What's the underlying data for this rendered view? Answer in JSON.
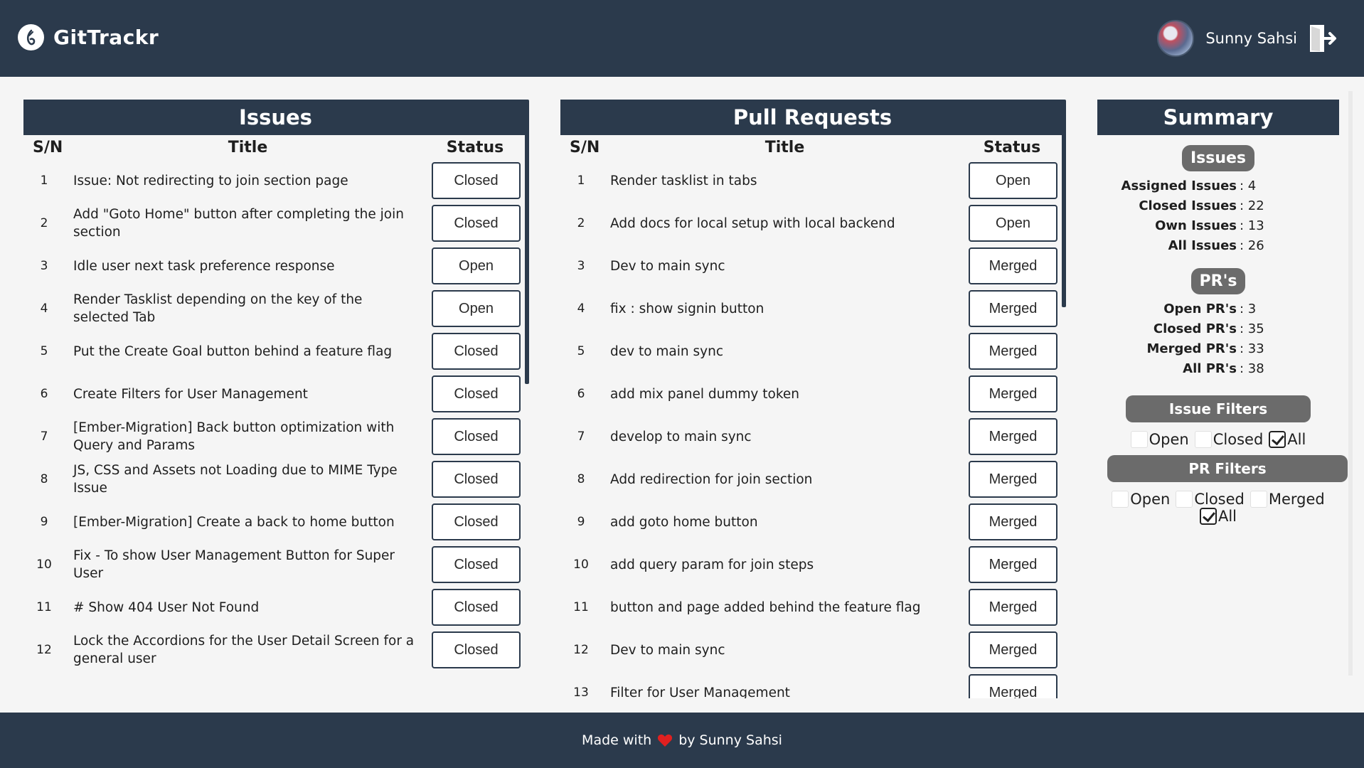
{
  "header": {
    "brand": "GitTrackr",
    "user_name": "Sunny Sahsi"
  },
  "issues": {
    "title": "Issues",
    "columns": [
      "S/N",
      "Title",
      "Status"
    ],
    "rows": [
      {
        "sn": "1",
        "title": "Issue: Not redirecting to join section page",
        "status": "Closed"
      },
      {
        "sn": "2",
        "title": "Add \"Goto Home\" button after completing the join section",
        "status": "Closed"
      },
      {
        "sn": "3",
        "title": "Idle user next task preference response",
        "status": "Open"
      },
      {
        "sn": "4",
        "title": "Render Tasklist depending on the key of the selected Tab",
        "status": "Open"
      },
      {
        "sn": "5",
        "title": "Put the Create Goal button behind a feature flag",
        "status": "Closed"
      },
      {
        "sn": "6",
        "title": "Create Filters for User Management",
        "status": "Closed"
      },
      {
        "sn": "7",
        "title": "[Ember-Migration] Back button optimization with Query and Params",
        "status": "Closed"
      },
      {
        "sn": "8",
        "title": "JS, CSS and Assets not Loading due to MIME Type Issue",
        "status": "Closed"
      },
      {
        "sn": "9",
        "title": "[Ember-Migration] Create a back to home button",
        "status": "Closed"
      },
      {
        "sn": "10",
        "title": "Fix - To show User Management Button for Super User",
        "status": "Closed"
      },
      {
        "sn": "11",
        "title": "# Show 404 User Not Found",
        "status": "Closed"
      },
      {
        "sn": "12",
        "title": "Lock the Accordions for the User Detail Screen for a general user",
        "status": "Closed"
      }
    ]
  },
  "pull_requests": {
    "title": "Pull Requests",
    "columns": [
      "S/N",
      "Title",
      "Status"
    ],
    "rows": [
      {
        "sn": "1",
        "title": "Render tasklist in tabs",
        "status": "Open"
      },
      {
        "sn": "2",
        "title": "Add docs for local setup with local backend",
        "status": "Open"
      },
      {
        "sn": "3",
        "title": "Dev to main sync",
        "status": "Merged"
      },
      {
        "sn": "4",
        "title": "fix : show signin button",
        "status": "Merged"
      },
      {
        "sn": "5",
        "title": "dev to main sync",
        "status": "Merged"
      },
      {
        "sn": "6",
        "title": "add mix panel dummy token",
        "status": "Merged"
      },
      {
        "sn": "7",
        "title": "develop to main sync",
        "status": "Merged"
      },
      {
        "sn": "8",
        "title": "Add redirection for join section",
        "status": "Merged"
      },
      {
        "sn": "9",
        "title": "add goto home button",
        "status": "Merged"
      },
      {
        "sn": "10",
        "title": "add query param for join steps",
        "status": "Merged"
      },
      {
        "sn": "11",
        "title": "button and page added behind the feature flag",
        "status": "Merged"
      },
      {
        "sn": "12",
        "title": "Dev to main sync",
        "status": "Merged"
      },
      {
        "sn": "13",
        "title": "Filter for User Management",
        "status": "Merged"
      }
    ]
  },
  "summary": {
    "title": "Summary",
    "issues_pill": "Issues",
    "issue_stats": [
      {
        "label": "Assigned Issues",
        "value": ": 4"
      },
      {
        "label": "Closed Issues",
        "value": ": 22"
      },
      {
        "label": "Own Issues",
        "value": ": 13"
      },
      {
        "label": "All Issues",
        "value": ": 26"
      }
    ],
    "prs_pill": "PR's",
    "pr_stats": [
      {
        "label": "Open PR's",
        "value": ": 3"
      },
      {
        "label": "Closed PR's",
        "value": ": 35"
      },
      {
        "label": "Merged PR's",
        "value": ": 33"
      },
      {
        "label": "All PR's",
        "value": ": 38"
      }
    ],
    "issue_filters": {
      "title": "Issue Filters",
      "options": [
        {
          "label": "Open",
          "checked": false
        },
        {
          "label": "Closed",
          "checked": false
        },
        {
          "label": "All",
          "checked": true
        }
      ]
    },
    "pr_filters": {
      "title": "PR Filters",
      "options": [
        {
          "label": "Open",
          "checked": false
        },
        {
          "label": "Closed",
          "checked": false
        },
        {
          "label": "Merged",
          "checked": false
        },
        {
          "label": "All",
          "checked": true
        }
      ]
    }
  },
  "footer": {
    "prefix": "Made with",
    "suffix": "by Sunny Sahsi",
    "heart_color": "#e02020"
  },
  "colors": {
    "header_bg": "#2b3a4c",
    "pill_bg": "#6b6b6b",
    "page_bg": "#f5f5f5"
  }
}
